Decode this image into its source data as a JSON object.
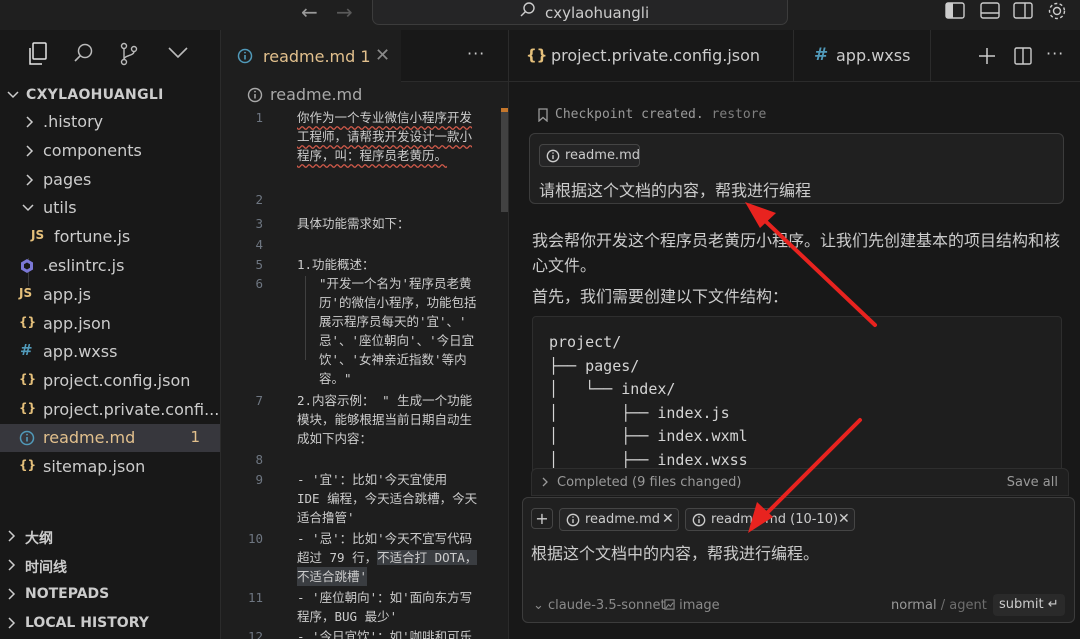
{
  "titlebar": {
    "search_text": "cxylaohuangli"
  },
  "explorer": {
    "root_label": "CXYLAOHUANGLI",
    "items": [
      {
        "label": ".history",
        "icon": "chevron-right-icon"
      },
      {
        "label": "components",
        "icon": "chevron-right-icon"
      },
      {
        "label": "pages",
        "icon": "chevron-right-icon"
      },
      {
        "label": "utils",
        "icon": "chevron-down-icon"
      },
      {
        "label": "fortune.js",
        "icon_text": "JS"
      },
      {
        "label": ".eslintrc.js",
        "icon": "eslint-icon"
      },
      {
        "label": "app.js",
        "icon_text": "JS"
      },
      {
        "label": "app.json",
        "icon_text": "{}"
      },
      {
        "label": "app.wxss",
        "icon_text": "#"
      },
      {
        "label": "project.config.json",
        "icon_text": "{}"
      },
      {
        "label": "project.private.confi...",
        "icon_text": "{}"
      },
      {
        "label": "readme.md",
        "icon": "info-icon",
        "badge": "1"
      },
      {
        "label": "sitemap.json",
        "icon_text": "{}"
      }
    ],
    "sections": [
      "大纲",
      "时间线",
      "NOTEPADS",
      "LOCAL HISTORY"
    ]
  },
  "editor1": {
    "tab_label": "readme.md",
    "tab_badge": "1",
    "breadcrumb": "readme.md",
    "lines": [
      {
        "num": "1",
        "text": [
          "你作为一个专业微信小程序开发",
          "工程师，请帮我开发设计一款小",
          "程序，叫：程序员老黄历。"
        ]
      },
      {
        "num": "2",
        "text": [
          ""
        ]
      },
      {
        "num": "3",
        "text": [
          "具体功能需求如下："
        ]
      },
      {
        "num": "4",
        "text": [
          ""
        ]
      },
      {
        "num": "5",
        "text": [
          "1.功能概述："
        ]
      },
      {
        "num": "6",
        "text": [
          "\"开发一个名为'程序员老黄",
          "历'的微信小程序，功能包括",
          "展示程序员每天的'宜'、'",
          "忌'、'座位朝向'、'今日宜",
          "饮'、'女神亲近指数'等内",
          "容。\""
        ]
      },
      {
        "num": "7",
        "text": [
          "2.内容示例： \" 生成一个功能",
          "模块，能够根据当前日期自动生",
          "成如下内容："
        ]
      },
      {
        "num": "8",
        "text": [
          ""
        ]
      },
      {
        "num": "9",
        "text": [
          "- '宜'：比如'今天宜使用",
          "IDE 编程，今天适合跳槽，今天",
          "适合撸管'"
        ]
      },
      {
        "num": "10",
        "text": [
          "- '忌'：比如'今天不宜写代码",
          "超过 79 行，",
          "不适合跳槽'"
        ]
      },
      {
        "num": "11",
        "text": [
          "- '座位朝向'：如'面向东方写",
          "程序，BUG 最少'"
        ]
      },
      {
        "num": "12",
        "text": [
          "- '今日宜饮'：如'咖啡和可乐",
          "'"
        ]
      }
    ],
    "highlight_text": "不适合打 DOTA，"
  },
  "chat": {
    "tab1_label": "project.private.config.json",
    "tab1_icon": "{}",
    "tab2_label": "app.wxss",
    "tab2_icon": "#",
    "checkpoint_text": "Checkpoint created.",
    "checkpoint_restore": "restore",
    "user_chip": "readme.md",
    "user_text": "请根据这个文档的内容，帮我进行编程",
    "ai_para1": "我会帮你开发这个程序员老黄历小程序。让我们先创建基本的项目结构和核心文件。",
    "ai_para2": "首先，我们需要创建以下文件结构：",
    "code_lines": [
      "project/",
      "├── pages/",
      "│   └── index/",
      "│       ├── index.js",
      "│       ├── index.wxml",
      "│       ├── index.wxss"
    ],
    "completed_label": "Completed",
    "completed_detail": "(9 files changed)",
    "save_all": "Save all",
    "composer_chip1": "readme.md",
    "composer_chip2": "readme.md (10-10)",
    "composer_text": "根据这个文档中的内容，帮我进行编程。",
    "model": "claude-3.5-sonnet",
    "image_label": "image",
    "mode_normal": "normal",
    "mode_sep": "/",
    "mode_agent": "agent",
    "submit_label": "submit ↵"
  },
  "colors": {
    "accent_modified": "#e2c08d",
    "annotation_arrow": "#e8231f"
  }
}
